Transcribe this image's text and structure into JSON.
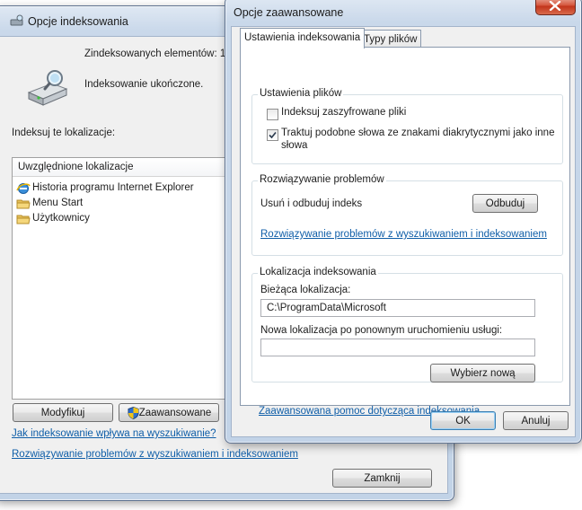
{
  "main_window": {
    "title": "Opcje indeksowania",
    "indexed_count_label": "Zindeksowanych elementów: 1",
    "status_text": "Indeksowanie ukończone.",
    "index_locations_label": "Indeksuj te lokalizacje:",
    "list_header": "Uwzględnione lokalizacje",
    "locations": [
      {
        "label": "Historia programu Internet Explorer",
        "icon": "internet-explorer-icon"
      },
      {
        "label": "Menu Start",
        "icon": "folder-icon"
      },
      {
        "label": "Użytkownicy",
        "icon": "folder-icon"
      }
    ],
    "modify_button": "Modyfikuj",
    "advanced_button": "Zaawansowane",
    "link_how_indexing_affects": "Jak indeksowanie wpływa na wyszukiwanie?",
    "link_troubleshoot": "Rozwiązywanie problemów z wyszukiwaniem i indeksowaniem",
    "close_button": "Zamknij"
  },
  "advanced_dialog": {
    "title": "Opcje zaawansowane",
    "tabs": [
      {
        "label": "Ustawienia indeksowania",
        "active": true
      },
      {
        "label": "Typy plików",
        "active": false
      }
    ],
    "file_settings": {
      "title": "Ustawienia plików",
      "encrypt_label": "Indeksuj zaszyfrowane pliki",
      "encrypt_checked": false,
      "diacritics_label_line1": "Traktuj podobne słowa ze znakami diakrytycznymi jako inne",
      "diacritics_label_line2": "słowa",
      "diacritics_checked": true
    },
    "troubleshooting": {
      "title": "Rozwiązywanie problemów",
      "rebuild_label": "Usuń i odbuduj indeks",
      "rebuild_button": "Odbuduj",
      "link": "Rozwiązywanie problemów z wyszukiwaniem i indeksowaniem"
    },
    "index_location": {
      "title": "Lokalizacja indeksowania",
      "current_label": "Bieżąca lokalizacja:",
      "current_value": "C:\\ProgramData\\Microsoft",
      "new_label": "Nowa lokalizacja po ponownym uruchomieniu usługi:",
      "new_value": "",
      "select_new_button": "Wybierz nową"
    },
    "help_link": "Zaawansowana pomoc dotycząca indeksowania",
    "ok_button": "OK",
    "cancel_button": "Anuluj"
  },
  "colors": {
    "link": "#0f5ea8",
    "close_button": "#c2331a",
    "frame": "#c2d3e7"
  }
}
